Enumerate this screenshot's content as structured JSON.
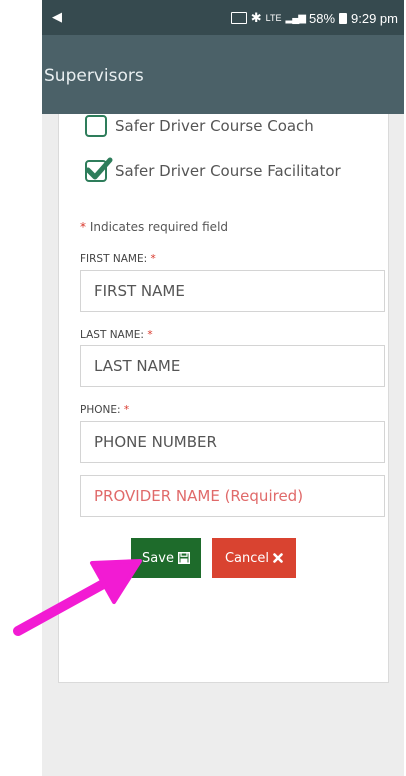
{
  "status_bar": {
    "battery": "58%",
    "time": "9:29 pm"
  },
  "header": {
    "title": "Supervisors"
  },
  "form": {
    "checkboxes": [
      {
        "label": "Safer Driver Course Coach",
        "checked": false
      },
      {
        "label": "Safer Driver Course Facilitator",
        "checked": true
      }
    ],
    "required_marker": "*",
    "required_note": "Indicates required field",
    "first_name": {
      "label": "FIRST NAME:",
      "placeholder": "FIRST NAME"
    },
    "last_name": {
      "label": "LAST NAME:",
      "placeholder": "LAST NAME"
    },
    "phone": {
      "label": "PHONE:",
      "placeholder": "PHONE NUMBER"
    },
    "provider": {
      "placeholder": "PROVIDER NAME (Required)"
    },
    "save_label": "Save",
    "cancel_label": "Cancel"
  },
  "icons": {
    "save": "floppy-disk-icon",
    "cancel": "close-icon",
    "annotation": "pointing-arrow"
  },
  "colors": {
    "header_bg": "#4b6168",
    "status_bg": "#364a4f",
    "checkbox": "#2e7d5b",
    "save": "#1e6b2b",
    "cancel": "#d94330",
    "required": "#d9372b",
    "arrow": "#f21bd3"
  }
}
